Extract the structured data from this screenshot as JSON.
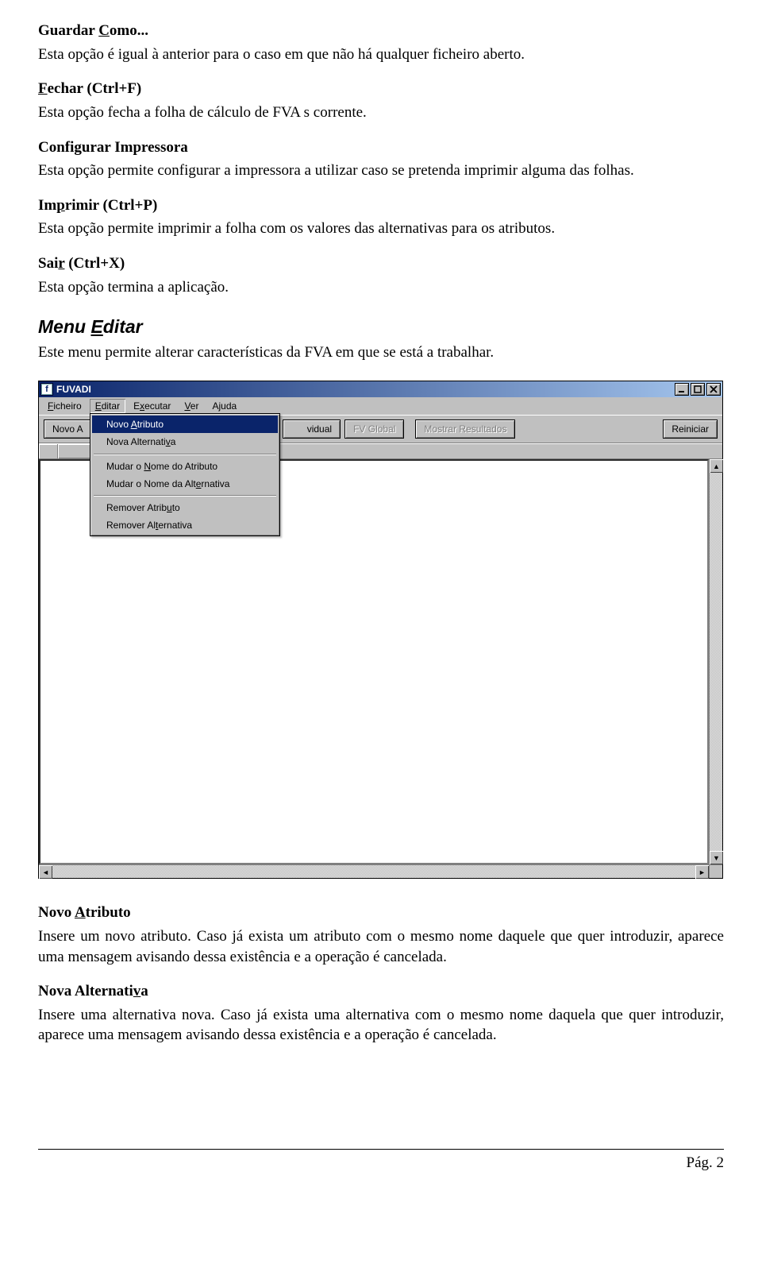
{
  "sections": {
    "guardar_como": {
      "title_pre": "Guardar ",
      "title_u": "C",
      "title_post": "omo...",
      "body": "Esta opção é igual à anterior para o caso em que não há qualquer ficheiro aberto."
    },
    "fechar": {
      "title_u": "F",
      "title_post": "echar (Ctrl+F)",
      "body": "Esta opção fecha a folha de cálculo de FVA s corrente."
    },
    "config_impressora": {
      "title": "Configurar Impressora",
      "body": "Esta opção permite configurar a impressora a utilizar caso se pretenda imprimir alguma das folhas."
    },
    "imprimir": {
      "title_pre": "Im",
      "title_u": "p",
      "title_post": "rimir (Ctrl+P)",
      "body": "Esta opção permite imprimir a folha com os valores das alternativas para os atributos."
    },
    "sair": {
      "title_pre": "Sai",
      "title_u": "r",
      "title_post": " (Ctrl+X)",
      "body": "Esta opção termina a aplicação."
    },
    "menu_editar": {
      "title_pre": "Menu ",
      "title_u": "E",
      "title_post": "ditar",
      "body": "Este menu permite alterar características da FVA em que se está a trabalhar."
    },
    "novo_atributo": {
      "title_pre": "Novo ",
      "title_u": "A",
      "title_post": "tributo",
      "body": "Insere um novo atributo. Caso já exista um atributo com o mesmo nome daquele que quer introduzir, aparece uma mensagem avisando dessa existência e a operação é cancelada."
    },
    "nova_alternativa": {
      "title_pre": "Nova Alternati",
      "title_u": "v",
      "title_post": "a",
      "body": "Insere uma alternativa nova. Caso já exista uma alternativa com o mesmo nome daquela que quer introduzir, aparece uma mensagem avisando dessa existência e a operação é cancelada."
    }
  },
  "screenshot": {
    "app_icon": "f",
    "title": "FUVADI",
    "menubar": {
      "ficheiro": {
        "pre": "",
        "u": "F",
        "post": "icheiro"
      },
      "editar": {
        "pre": "",
        "u": "E",
        "post": "ditar"
      },
      "executar": {
        "pre": "E",
        "u": "x",
        "post": "ecutar"
      },
      "ver": {
        "pre": "",
        "u": "V",
        "post": "er"
      },
      "ajuda": {
        "pre": "A",
        "u": "j",
        "post": "uda"
      }
    },
    "toolbar": {
      "novo_a": "Novo A",
      "vidual": "vidual",
      "fv_global": "FV Global",
      "mostrar": "Mostrar Resultados",
      "reiniciar": "Reiniciar"
    },
    "dropdown": [
      {
        "pre": "Novo ",
        "u": "A",
        "post": "tributo",
        "hl": true
      },
      {
        "pre": "Nova Alternati",
        "u": "v",
        "post": "a"
      },
      "-",
      {
        "pre": "Mudar o ",
        "u": "N",
        "post": "ome do Atributo"
      },
      {
        "pre": "Mudar o Nome da Alt",
        "u": "e",
        "post": "rnativa"
      },
      "-",
      {
        "pre": "Remover Atrib",
        "u": "u",
        "post": "to"
      },
      {
        "pre": "Remover Al",
        "u": "t",
        "post": "ernativa"
      }
    ]
  },
  "footer": {
    "label": "Pág. ",
    "num": "2"
  }
}
